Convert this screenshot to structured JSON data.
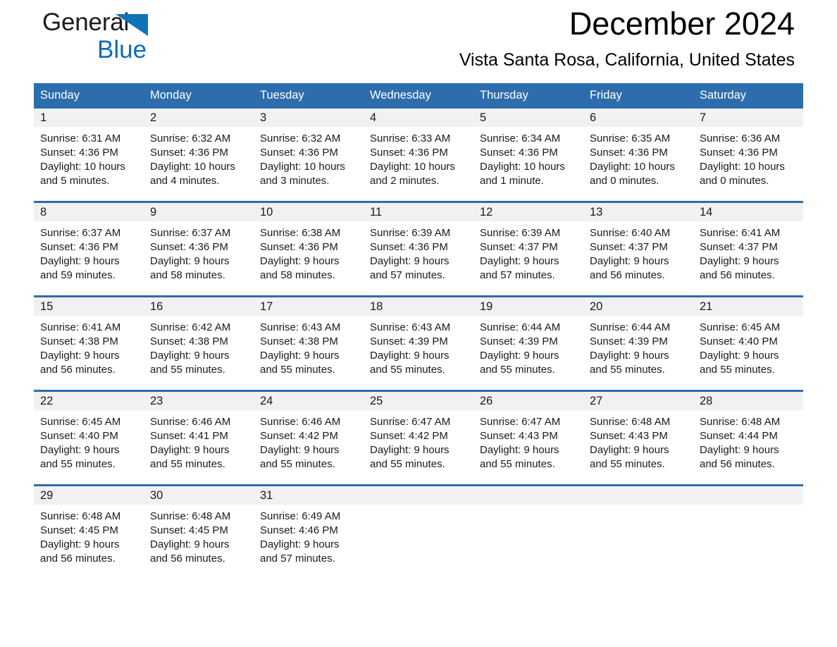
{
  "brand": {
    "name_part1": "General",
    "name_part2": "Blue",
    "logo_triangle_color": "#1073B8",
    "text_color": "#1A1A1A"
  },
  "header": {
    "title": "December 2024",
    "subtitle": "Vista Santa Rosa, California, United States"
  },
  "theme": {
    "header_blue": "#2E6DAD",
    "day_band_gray": "#F1F1F1",
    "page_background": "#FFFFFF"
  },
  "weekdays": [
    "Sunday",
    "Monday",
    "Tuesday",
    "Wednesday",
    "Thursday",
    "Friday",
    "Saturday"
  ],
  "weeks": [
    [
      {
        "day": "1",
        "sunrise": "Sunrise: 6:31 AM",
        "sunset": "Sunset: 4:36 PM",
        "daylight_line1": "Daylight: 10 hours",
        "daylight_line2": "and 5 minutes."
      },
      {
        "day": "2",
        "sunrise": "Sunrise: 6:32 AM",
        "sunset": "Sunset: 4:36 PM",
        "daylight_line1": "Daylight: 10 hours",
        "daylight_line2": "and 4 minutes."
      },
      {
        "day": "3",
        "sunrise": "Sunrise: 6:32 AM",
        "sunset": "Sunset: 4:36 PM",
        "daylight_line1": "Daylight: 10 hours",
        "daylight_line2": "and 3 minutes."
      },
      {
        "day": "4",
        "sunrise": "Sunrise: 6:33 AM",
        "sunset": "Sunset: 4:36 PM",
        "daylight_line1": "Daylight: 10 hours",
        "daylight_line2": "and 2 minutes."
      },
      {
        "day": "5",
        "sunrise": "Sunrise: 6:34 AM",
        "sunset": "Sunset: 4:36 PM",
        "daylight_line1": "Daylight: 10 hours",
        "daylight_line2": "and 1 minute."
      },
      {
        "day": "6",
        "sunrise": "Sunrise: 6:35 AM",
        "sunset": "Sunset: 4:36 PM",
        "daylight_line1": "Daylight: 10 hours",
        "daylight_line2": "and 0 minutes."
      },
      {
        "day": "7",
        "sunrise": "Sunrise: 6:36 AM",
        "sunset": "Sunset: 4:36 PM",
        "daylight_line1": "Daylight: 10 hours",
        "daylight_line2": "and 0 minutes."
      }
    ],
    [
      {
        "day": "8",
        "sunrise": "Sunrise: 6:37 AM",
        "sunset": "Sunset: 4:36 PM",
        "daylight_line1": "Daylight: 9 hours",
        "daylight_line2": "and 59 minutes."
      },
      {
        "day": "9",
        "sunrise": "Sunrise: 6:37 AM",
        "sunset": "Sunset: 4:36 PM",
        "daylight_line1": "Daylight: 9 hours",
        "daylight_line2": "and 58 minutes."
      },
      {
        "day": "10",
        "sunrise": "Sunrise: 6:38 AM",
        "sunset": "Sunset: 4:36 PM",
        "daylight_line1": "Daylight: 9 hours",
        "daylight_line2": "and 58 minutes."
      },
      {
        "day": "11",
        "sunrise": "Sunrise: 6:39 AM",
        "sunset": "Sunset: 4:36 PM",
        "daylight_line1": "Daylight: 9 hours",
        "daylight_line2": "and 57 minutes."
      },
      {
        "day": "12",
        "sunrise": "Sunrise: 6:39 AM",
        "sunset": "Sunset: 4:37 PM",
        "daylight_line1": "Daylight: 9 hours",
        "daylight_line2": "and 57 minutes."
      },
      {
        "day": "13",
        "sunrise": "Sunrise: 6:40 AM",
        "sunset": "Sunset: 4:37 PM",
        "daylight_line1": "Daylight: 9 hours",
        "daylight_line2": "and 56 minutes."
      },
      {
        "day": "14",
        "sunrise": "Sunrise: 6:41 AM",
        "sunset": "Sunset: 4:37 PM",
        "daylight_line1": "Daylight: 9 hours",
        "daylight_line2": "and 56 minutes."
      }
    ],
    [
      {
        "day": "15",
        "sunrise": "Sunrise: 6:41 AM",
        "sunset": "Sunset: 4:38 PM",
        "daylight_line1": "Daylight: 9 hours",
        "daylight_line2": "and 56 minutes."
      },
      {
        "day": "16",
        "sunrise": "Sunrise: 6:42 AM",
        "sunset": "Sunset: 4:38 PM",
        "daylight_line1": "Daylight: 9 hours",
        "daylight_line2": "and 55 minutes."
      },
      {
        "day": "17",
        "sunrise": "Sunrise: 6:43 AM",
        "sunset": "Sunset: 4:38 PM",
        "daylight_line1": "Daylight: 9 hours",
        "daylight_line2": "and 55 minutes."
      },
      {
        "day": "18",
        "sunrise": "Sunrise: 6:43 AM",
        "sunset": "Sunset: 4:39 PM",
        "daylight_line1": "Daylight: 9 hours",
        "daylight_line2": "and 55 minutes."
      },
      {
        "day": "19",
        "sunrise": "Sunrise: 6:44 AM",
        "sunset": "Sunset: 4:39 PM",
        "daylight_line1": "Daylight: 9 hours",
        "daylight_line2": "and 55 minutes."
      },
      {
        "day": "20",
        "sunrise": "Sunrise: 6:44 AM",
        "sunset": "Sunset: 4:39 PM",
        "daylight_line1": "Daylight: 9 hours",
        "daylight_line2": "and 55 minutes."
      },
      {
        "day": "21",
        "sunrise": "Sunrise: 6:45 AM",
        "sunset": "Sunset: 4:40 PM",
        "daylight_line1": "Daylight: 9 hours",
        "daylight_line2": "and 55 minutes."
      }
    ],
    [
      {
        "day": "22",
        "sunrise": "Sunrise: 6:45 AM",
        "sunset": "Sunset: 4:40 PM",
        "daylight_line1": "Daylight: 9 hours",
        "daylight_line2": "and 55 minutes."
      },
      {
        "day": "23",
        "sunrise": "Sunrise: 6:46 AM",
        "sunset": "Sunset: 4:41 PM",
        "daylight_line1": "Daylight: 9 hours",
        "daylight_line2": "and 55 minutes."
      },
      {
        "day": "24",
        "sunrise": "Sunrise: 6:46 AM",
        "sunset": "Sunset: 4:42 PM",
        "daylight_line1": "Daylight: 9 hours",
        "daylight_line2": "and 55 minutes."
      },
      {
        "day": "25",
        "sunrise": "Sunrise: 6:47 AM",
        "sunset": "Sunset: 4:42 PM",
        "daylight_line1": "Daylight: 9 hours",
        "daylight_line2": "and 55 minutes."
      },
      {
        "day": "26",
        "sunrise": "Sunrise: 6:47 AM",
        "sunset": "Sunset: 4:43 PM",
        "daylight_line1": "Daylight: 9 hours",
        "daylight_line2": "and 55 minutes."
      },
      {
        "day": "27",
        "sunrise": "Sunrise: 6:48 AM",
        "sunset": "Sunset: 4:43 PM",
        "daylight_line1": "Daylight: 9 hours",
        "daylight_line2": "and 55 minutes."
      },
      {
        "day": "28",
        "sunrise": "Sunrise: 6:48 AM",
        "sunset": "Sunset: 4:44 PM",
        "daylight_line1": "Daylight: 9 hours",
        "daylight_line2": "and 56 minutes."
      }
    ],
    [
      {
        "day": "29",
        "sunrise": "Sunrise: 6:48 AM",
        "sunset": "Sunset: 4:45 PM",
        "daylight_line1": "Daylight: 9 hours",
        "daylight_line2": "and 56 minutes."
      },
      {
        "day": "30",
        "sunrise": "Sunrise: 6:48 AM",
        "sunset": "Sunset: 4:45 PM",
        "daylight_line1": "Daylight: 9 hours",
        "daylight_line2": "and 56 minutes."
      },
      {
        "day": "31",
        "sunrise": "Sunrise: 6:49 AM",
        "sunset": "Sunset: 4:46 PM",
        "daylight_line1": "Daylight: 9 hours",
        "daylight_line2": "and 57 minutes."
      },
      {
        "day": "",
        "sunrise": "",
        "sunset": "",
        "daylight_line1": "",
        "daylight_line2": ""
      },
      {
        "day": "",
        "sunrise": "",
        "sunset": "",
        "daylight_line1": "",
        "daylight_line2": ""
      },
      {
        "day": "",
        "sunrise": "",
        "sunset": "",
        "daylight_line1": "",
        "daylight_line2": ""
      },
      {
        "day": "",
        "sunrise": "",
        "sunset": "",
        "daylight_line1": "",
        "daylight_line2": ""
      }
    ]
  ]
}
